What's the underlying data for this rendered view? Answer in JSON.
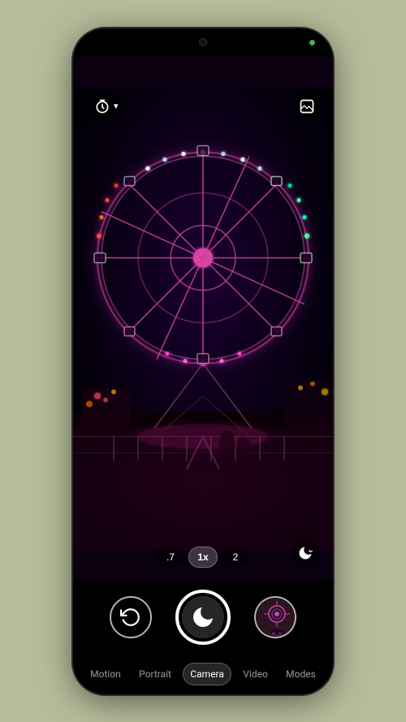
{
  "phone": {
    "statusDotColor": "#4CAF50"
  },
  "camera": {
    "timerLabel": "⏱",
    "chevron": "▾",
    "zoomLevels": [
      {
        "label": ".7",
        "active": false
      },
      {
        "label": "1x",
        "active": true
      },
      {
        "label": "2",
        "active": false
      }
    ],
    "nightModeIcon": "🌙",
    "rotateIcon": "↺",
    "galleryIcon": "⊡"
  },
  "nav": {
    "items": [
      {
        "label": "Motion",
        "active": false
      },
      {
        "label": "Portrait",
        "active": false
      },
      {
        "label": "Camera",
        "active": true
      },
      {
        "label": "Video",
        "active": false
      },
      {
        "label": "Modes",
        "active": false
      }
    ]
  }
}
